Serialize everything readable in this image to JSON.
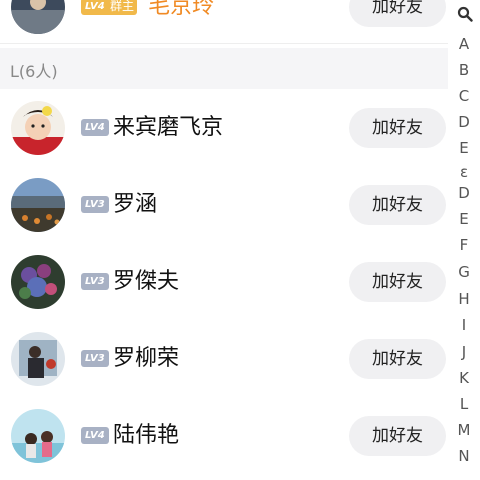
{
  "top_row": {
    "level": "LV4",
    "owner_badge": "群主",
    "name": "毛京玲",
    "button": "加好友"
  },
  "section": {
    "header": "L(6人)"
  },
  "members": [
    {
      "level": "LV4",
      "name": "来宾磨飞京",
      "button": "加好友"
    },
    {
      "level": "LV3",
      "name": "罗涵",
      "button": "加好友"
    },
    {
      "level": "LV3",
      "name": "罗傑夫",
      "button": "加好友"
    },
    {
      "level": "LV3",
      "name": "罗柳荣",
      "button": "加好友"
    },
    {
      "level": "LV4",
      "name": "陆伟艳",
      "button": "加好友"
    }
  ],
  "index_letters": [
    "A",
    "B",
    "C",
    "D",
    "E",
    "ε",
    "D",
    "E",
    "F",
    "G",
    "H",
    "I",
    "J",
    "K",
    "L",
    "M",
    "N"
  ],
  "colors": {
    "owner_badge": "#f1b94a",
    "owner_name": "#f08a24",
    "level_badge": "#a8b1c4"
  },
  "icons": {
    "index_search": "search-icon"
  }
}
